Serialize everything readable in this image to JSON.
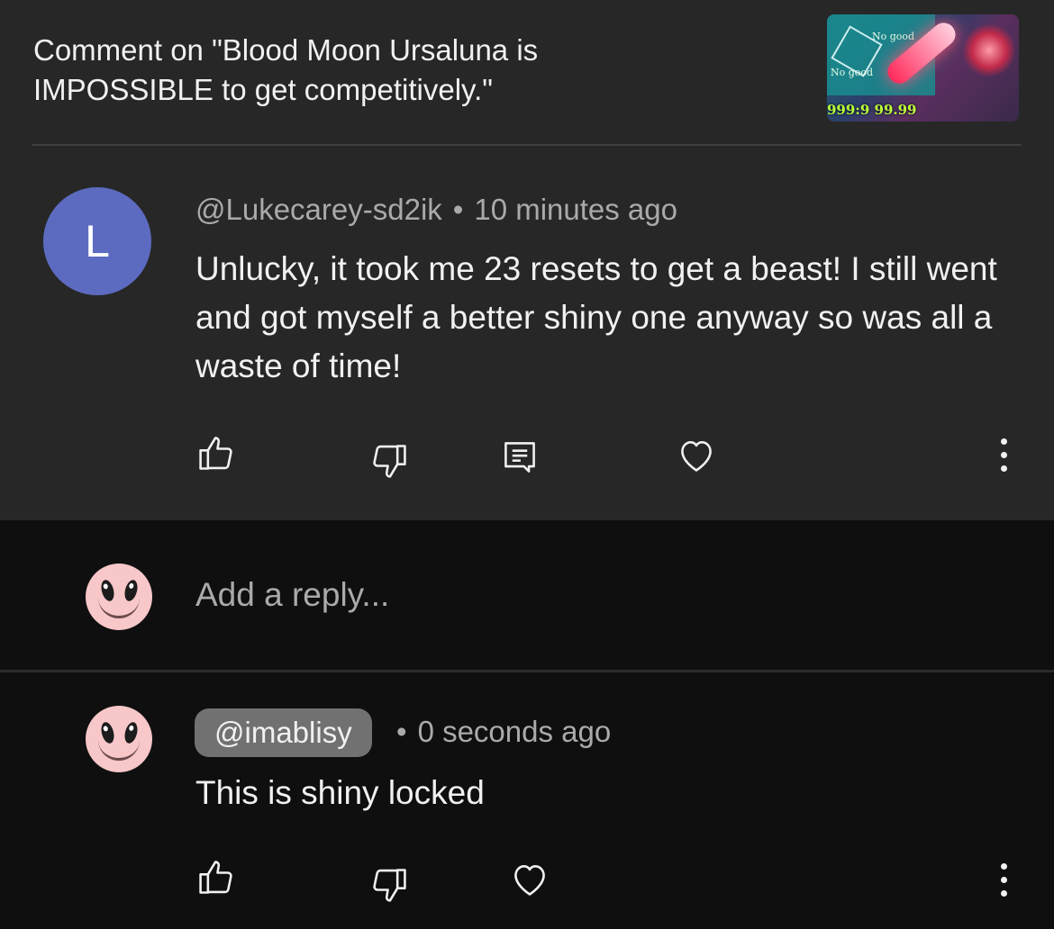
{
  "header": {
    "title": "Comment on \"Blood Moon Ursaluna is IMPOSSIBLE to get competitively.\"",
    "thumbnail": {
      "stat_label_1": "No good",
      "stat_label_2": "No good",
      "numbers": "999:9 99.99"
    }
  },
  "comment": {
    "avatar_letter": "L",
    "avatar_color": "#5c6bc0",
    "author": "@Lukecarey-sd2ik",
    "separator": "•",
    "time": "10 minutes ago",
    "text": "Unlucky, it took me 23 resets to get a beast! I still went and got myself a better shiny one anyway so was all a waste of time!",
    "actions": [
      "thumbs-up-icon",
      "thumbs-down-icon",
      "reply-icon",
      "heart-icon",
      "more-icon"
    ]
  },
  "reply_box": {
    "placeholder": "Add a reply..."
  },
  "reply": {
    "author": "@imablisy",
    "separator": "•",
    "time": "0 seconds ago",
    "text": "This is shiny locked",
    "actions": [
      "thumbs-up-icon",
      "thumbs-down-icon",
      "heart-icon",
      "more-icon"
    ]
  },
  "colors": {
    "top_background": "#272727",
    "page_background": "#0f0f0f",
    "chip_background": "#717171",
    "avatar_face": "#f7c7c9"
  }
}
